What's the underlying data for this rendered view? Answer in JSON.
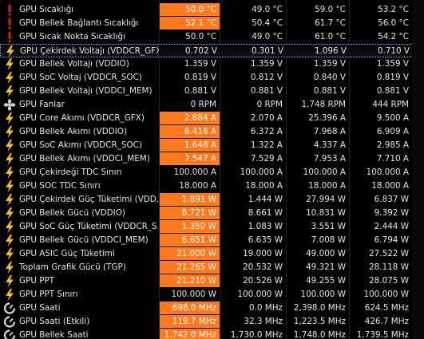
{
  "colors": {
    "highlight": "#ff7a1f",
    "background": "#000000",
    "text": "#e4e4e4"
  },
  "rows": [
    {
      "icon": "exclamation-icon",
      "label": "GPU Sıcaklığı",
      "cur": "50.0 °C",
      "min": "49.0 °C",
      "max": "59.0 °C",
      "avg": "53.2 °C",
      "hl": true
    },
    {
      "icon": "exclamation-icon",
      "label": "GPU Bellek Bağlantı Sıcaklığı",
      "cur": "52.1 °C",
      "min": "50.4 °C",
      "max": "61.7 °C",
      "avg": "56.0 °C",
      "hl": true
    },
    {
      "icon": "exclamation-icon",
      "label": "GPU Sıcak Nokta Sıcaklığı",
      "cur": "50.0 °C",
      "min": "49.0 °C",
      "max": "61.0 °C",
      "avg": "54.2 °C",
      "hl": false
    },
    {
      "icon": "lightning-icon",
      "label": "GPU Çekirdek Voltajı (VDDCR_GFX)",
      "cur": "0.702 V",
      "min": "0.301 V",
      "max": "1.096 V",
      "avg": "0.710 V",
      "hl": false,
      "selected": true
    },
    {
      "icon": "lightning-icon",
      "label": "GPU Bellek Voltajı (VDDIO)",
      "cur": "1.359 V",
      "min": "1.359 V",
      "max": "1.359 V",
      "avg": "1.359 V",
      "hl": false
    },
    {
      "icon": "lightning-icon",
      "label": "GPU SoC Voltaj (VDDCR_SOC)",
      "cur": "0.819 V",
      "min": "0.812 V",
      "max": "0.840 V",
      "avg": "0.819 V",
      "hl": false
    },
    {
      "icon": "lightning-icon",
      "label": "GPU Bellek Voltajı (VDDCI_MEM)",
      "cur": "0.881 V",
      "min": "0.881 V",
      "max": "0.881 V",
      "avg": "0.881 V",
      "hl": false
    },
    {
      "icon": "fan-icon",
      "label": "GPU Fanlar",
      "cur": "0 RPM",
      "min": "0 RPM",
      "max": "1,748 RPM",
      "avg": "444 RPM",
      "hl": false
    },
    {
      "icon": "lightning-icon",
      "label": "GPU Core Akımı (VDDCR_GFX)",
      "cur": "2.684 A",
      "min": "2.070 A",
      "max": "25.396 A",
      "avg": "9.500 A",
      "hl": true
    },
    {
      "icon": "lightning-icon",
      "label": "GPU Bellek Akımı (VDDIO)",
      "cur": "6.416 A",
      "min": "6.372 A",
      "max": "7.968 A",
      "avg": "6.909 A",
      "hl": true
    },
    {
      "icon": "lightning-icon",
      "label": "GPU SoC Akımı (VDDCR_SOC)",
      "cur": "1.648 A",
      "min": "1.322 A",
      "max": "4.337 A",
      "avg": "2.985 A",
      "hl": true
    },
    {
      "icon": "lightning-icon",
      "label": "GPU Bellek Akımı (VDDCI_MEM)",
      "cur": "7.547 A",
      "min": "7.529 A",
      "max": "7.953 A",
      "avg": "7.710 A",
      "hl": true
    },
    {
      "icon": "lightning-icon",
      "label": "GPU Çekirdeği TDC Sınırı",
      "cur": "100.000 A",
      "min": "100.000 A",
      "max": "100.000 A",
      "avg": "100.000 A",
      "hl": false
    },
    {
      "icon": "lightning-icon",
      "label": "GPU SOC TDC Sınırı",
      "cur": "18.000 A",
      "min": "18.000 A",
      "max": "18.000 A",
      "avg": "18.000 A",
      "hl": false
    },
    {
      "icon": "lightning-icon",
      "label": "GPU Çekirdek Güç Tüketimi (VDD...",
      "cur": "1.891 W",
      "min": "1.444 W",
      "max": "27.994 W",
      "avg": "6.837 W",
      "hl": true
    },
    {
      "icon": "lightning-icon",
      "label": "GPU Bellek Gücü (VDDIO)",
      "cur": "8.721 W",
      "min": "8.661 W",
      "max": "10.831 W",
      "avg": "9.392 W",
      "hl": true
    },
    {
      "icon": "lightning-icon",
      "label": "GPU SoC Güç Tüketimi (VDDCR_S...",
      "cur": "1.350 W",
      "min": "1.083 W",
      "max": "3.551 W",
      "avg": "2.444 W",
      "hl": true
    },
    {
      "icon": "lightning-icon",
      "label": "GPU Bellek Gücü (VDDCI_MEM)",
      "cur": "6.651 W",
      "min": "6.635 W",
      "max": "7.008 W",
      "avg": "6.794 W",
      "hl": true
    },
    {
      "icon": "lightning-icon",
      "label": "GPU ASIC Güç Tüketimi",
      "cur": "21.000 W",
      "min": "19.000 W",
      "max": "49.000 W",
      "avg": "27.522 W",
      "hl": true
    },
    {
      "icon": "lightning-icon",
      "label": "Toplam Grafik Gücü (TGP)",
      "cur": "21.265 W",
      "min": "20.532 W",
      "max": "49.321 W",
      "avg": "28.118 W",
      "hl": true
    },
    {
      "icon": "lightning-icon",
      "label": "GPU PPT",
      "cur": "21.210 W",
      "min": "20.526 W",
      "max": "49.255 W",
      "avg": "28.075 W",
      "hl": true
    },
    {
      "icon": "lightning-icon",
      "label": "GPU PPT Sınırı",
      "cur": "100.000 W",
      "min": "100.000 W",
      "max": "100.000 W",
      "avg": "100.000 W",
      "hl": false
    },
    {
      "icon": "clock-icon",
      "label": "GPU Saati",
      "cur": "698.0 MHz",
      "min": "0.0 MHz",
      "max": "2,398.0 MHz",
      "avg": "624.5 MHz",
      "hl": true
    },
    {
      "icon": "clock-icon",
      "label": "GPU Saati (Etkili)",
      "cur": "119.7 MHz",
      "min": "32.3 MHz",
      "max": "1,223.5 MHz",
      "avg": "426.7 MHz",
      "hl": true
    },
    {
      "icon": "clock-icon",
      "label": "GPU Bellek Saati",
      "cur": "1,742.0 MHz",
      "min": "1,730.0 MHz",
      "max": "1,748.0 MHz",
      "avg": "1,739.5 MHz",
      "hl": true
    }
  ]
}
